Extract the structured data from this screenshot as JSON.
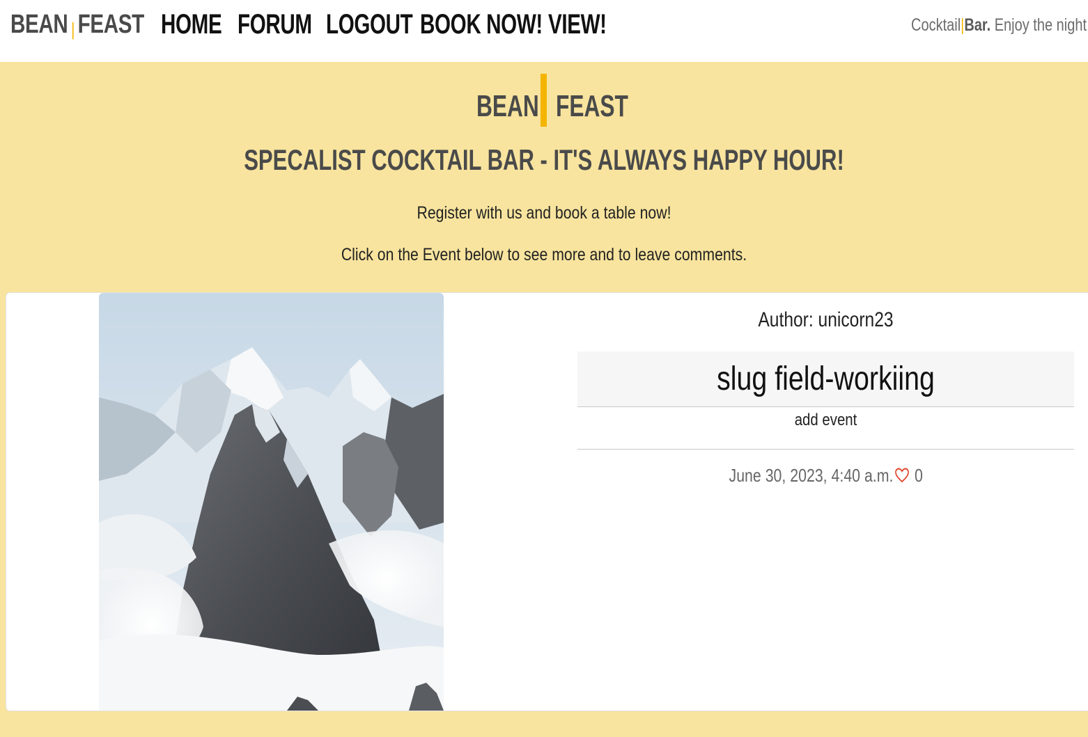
{
  "nav": {
    "brand_left": "BEAN",
    "brand_sep": "|",
    "brand_right": "FEAST",
    "links": [
      "HOME",
      "FORUM",
      "LOGOUT",
      "BOOK NOW!",
      "VIEW!"
    ],
    "tagline_pre": "Cocktail",
    "tagline_sep": "|",
    "tagline_bold": "Bar.",
    "tagline_post": " Enjoy the night"
  },
  "hero": {
    "logo_left": "BEAN",
    "logo_right": "FEAST",
    "title": "SPECALIST COCKTAIL BAR - IT'S ALWAYS HAPPY HOUR!",
    "line1": "Register with us and book a table now!",
    "line2": "Click on the Event below to see more and to leave comments."
  },
  "post": {
    "author": "Author: unicorn23",
    "title": "slug field-workiing",
    "excerpt": "add event",
    "date": "June 30, 2023, 4:40 a.m.",
    "likes": "0"
  },
  "colors": {
    "accent": "#f4b400",
    "background": "#f8e49e",
    "heart": "#e0442b"
  }
}
